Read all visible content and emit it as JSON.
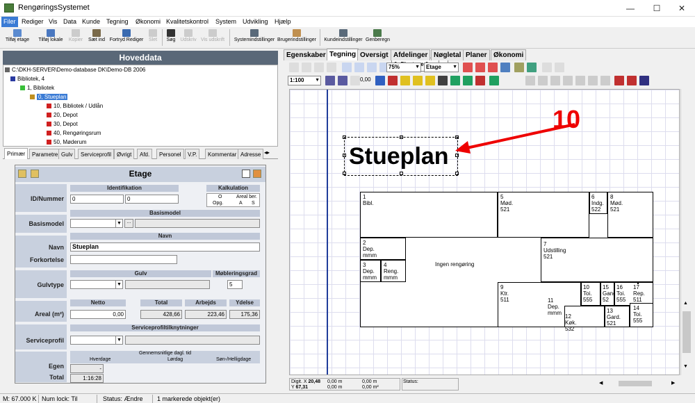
{
  "window": {
    "title": "RengøringsSystemet",
    "minimize": "—",
    "maximize": "☐",
    "close": "✕"
  },
  "menu": [
    "Filer",
    "Rediger",
    "Vis",
    "Data",
    "Kunde",
    "Tegning",
    "Økonomi",
    "Kvalitetskontrol",
    "System",
    "Udvikling",
    "Hjælp"
  ],
  "toolbar": {
    "buttons": [
      "Tilføj etage",
      "Tilføj lokale",
      "Kopier",
      "Sæt ind",
      "Fortryd Rediger",
      "Slet",
      "Søg",
      "Udskriv",
      "Vis udskrift",
      "Systemindstillinger",
      "Brugerindstillinger",
      "Kundeindstillinger",
      "Genberegn"
    ],
    "plantype": "0: Plantype 0",
    "plantype_btn": "..."
  },
  "left": {
    "header": "Hoveddata",
    "tree": [
      {
        "label": "C:\\DKH-SERVER\\Demo-database DK\\Demo-DB 2006"
      },
      {
        "label": "Bibliotek, 4"
      },
      {
        "label": "1, Bibliotek"
      },
      {
        "label": "0, Stueplan"
      },
      {
        "label": "10, Bibliotek / Udlån"
      },
      {
        "label": "20, Depot"
      },
      {
        "label": "30, Depot"
      },
      {
        "label": "40, Rengøringsrum"
      },
      {
        "label": "50, Møderum"
      }
    ],
    "tabs": [
      "Primær",
      "Parametre",
      "Gulv",
      "Serviceprofil",
      "Øvrigt",
      "Afd.",
      "Personel",
      "V.P.",
      "Kommentar",
      "Adresse"
    ],
    "form": {
      "title": "Etage",
      "sections": {
        "identifikation": "Identifikation",
        "kalkulation": "Kalkulation",
        "basismodel": "Basismodel",
        "navn": "Navn",
        "gulv": "Gulv",
        "moebleringsgrad": "Møbleringsgrad",
        "netto": "Netto",
        "total": "Total",
        "arbejds": "Arbejds",
        "ydelse": "Ydelse",
        "serviceprofil": "Serviceprofiltilknytninger",
        "gennemsnit": "Gennemsnitlige dagl. tid",
        "hverdage": "Hverdage",
        "loerdag": "Lørdag",
        "soen": "Søn-/Helligdage"
      },
      "labels": {
        "id": "ID/Nummer",
        "basismodel": "Basismodel",
        "navn": "Navn",
        "forkortelse": "Forkortelse",
        "gulvtype": "Gulvtype",
        "areal": "Areal (m²)",
        "serviceprofil": "Serviceprofil",
        "egen": "Egen",
        "total": "Total"
      },
      "values": {
        "id1": "0",
        "id2": "0",
        "kalk_o": "O",
        "kalk_areal": "Areal ber.",
        "kalk_opg": "Opg.",
        "kalk_a": "A",
        "kalk_s": "S",
        "basis_btn": "...",
        "navn": "Stueplan",
        "forkortelse": "",
        "moebleringsgrad": "5",
        "netto": "0,00",
        "total": "428,66",
        "arbejds": "223,46",
        "ydelse": "175,36",
        "egen": "-",
        "total_time": "1:16:28"
      }
    }
  },
  "right": {
    "tabs": [
      "Egenskaber",
      "Tegning",
      "Oversigt",
      "Afdelinger",
      "Nøgletal",
      "Planer",
      "Økonomi"
    ],
    "zoom": "75%",
    "level": "Etage",
    "scale": "1:100",
    "linewidth": "0,00",
    "annotation": "10",
    "plan_title": "Stueplan",
    "rooms": [
      {
        "num": "1",
        "name": "Bibl.",
        "code": ""
      },
      {
        "num": "5",
        "name": "Mød.",
        "code": "521"
      },
      {
        "num": "6",
        "name": "Indg.",
        "code": "522"
      },
      {
        "num": "8",
        "name": "Mød.",
        "code": "521"
      },
      {
        "num": "2",
        "name": "Dep.",
        "code": "mmm"
      },
      {
        "num": "3",
        "name": "Dep.",
        "code": "mmm"
      },
      {
        "num": "4",
        "name": "Reng.",
        "code": "mmm"
      },
      {
        "num": "7",
        "name": "Udstilling",
        "code": "521"
      },
      {
        "num": "9",
        "name": "Ktr.",
        "code": "511"
      },
      {
        "num": "10",
        "name": "Toi.",
        "code": "555"
      },
      {
        "num": "15",
        "name": "Gang",
        "code": "52"
      },
      {
        "num": "16",
        "name": "Toi.",
        "code": "555"
      },
      {
        "num": "17",
        "name": "Rep.",
        "code": "511"
      },
      {
        "num": "11",
        "name": "Dep.",
        "code": "mmm"
      },
      {
        "num": "12",
        "name": "Køk.",
        "code": "532"
      },
      {
        "num": "13",
        "name": "Gard.",
        "code": "521"
      },
      {
        "num": "14",
        "name": "Toi.",
        "code": "555"
      }
    ],
    "center_label": "Ingen rengøring",
    "coords": {
      "x_label": "Digit. X",
      "x": "20,48",
      "y_label": "Y",
      "y": "67,31",
      "dx": "0,00 m",
      "dy": "0,00 m",
      "a": "0,00 m",
      "area": "0,00 m²",
      "status_label": "Status:"
    }
  },
  "statusbar": {
    "memory": "M: 67.000 K",
    "numlock": "Num lock: Til",
    "status": "Status: Ændre",
    "selection": "1 markerede objekt(er)"
  }
}
